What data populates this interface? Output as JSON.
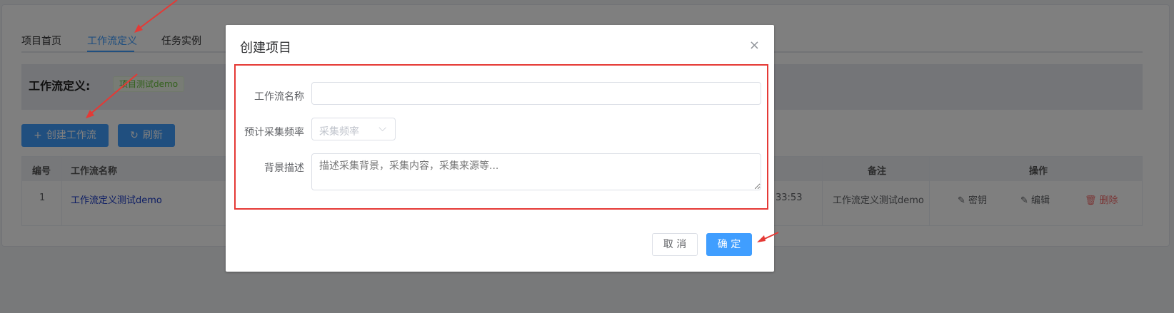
{
  "tabs": [
    {
      "label": "项目首页"
    },
    {
      "label": "工作流定义"
    },
    {
      "label": "任务实例"
    }
  ],
  "header": {
    "title": "工作流定义:",
    "tag": "项目测试demo"
  },
  "toolbar": {
    "create_label": "创建工作流",
    "refresh_label": "刷新"
  },
  "table": {
    "headers": {
      "id": "编号",
      "name": "工作流名称",
      "remark": "备注",
      "ops": "操作"
    },
    "rows": [
      {
        "id": "1",
        "name": "工作流定义测试demo",
        "time_fragment": "33:53",
        "remark": "工作流定义测试demo"
      }
    ],
    "ops": {
      "secret": "密钥",
      "edit": "编辑",
      "delete": "删除"
    }
  },
  "dialog": {
    "title": "创建项目",
    "close": "×",
    "fields": {
      "name_label": "工作流名称",
      "name_value": "",
      "freq_label": "预计采集频率",
      "freq_placeholder": "采集频率",
      "desc_label": "背景描述",
      "desc_placeholder": "描述采集背景，采集内容，采集来源等..."
    },
    "cancel_label": "取 消",
    "ok_label": "确 定"
  },
  "colors": {
    "primary": "#409eff",
    "danger": "#f56c6c",
    "annotation": "#e53935",
    "tag": "#67c23a"
  }
}
